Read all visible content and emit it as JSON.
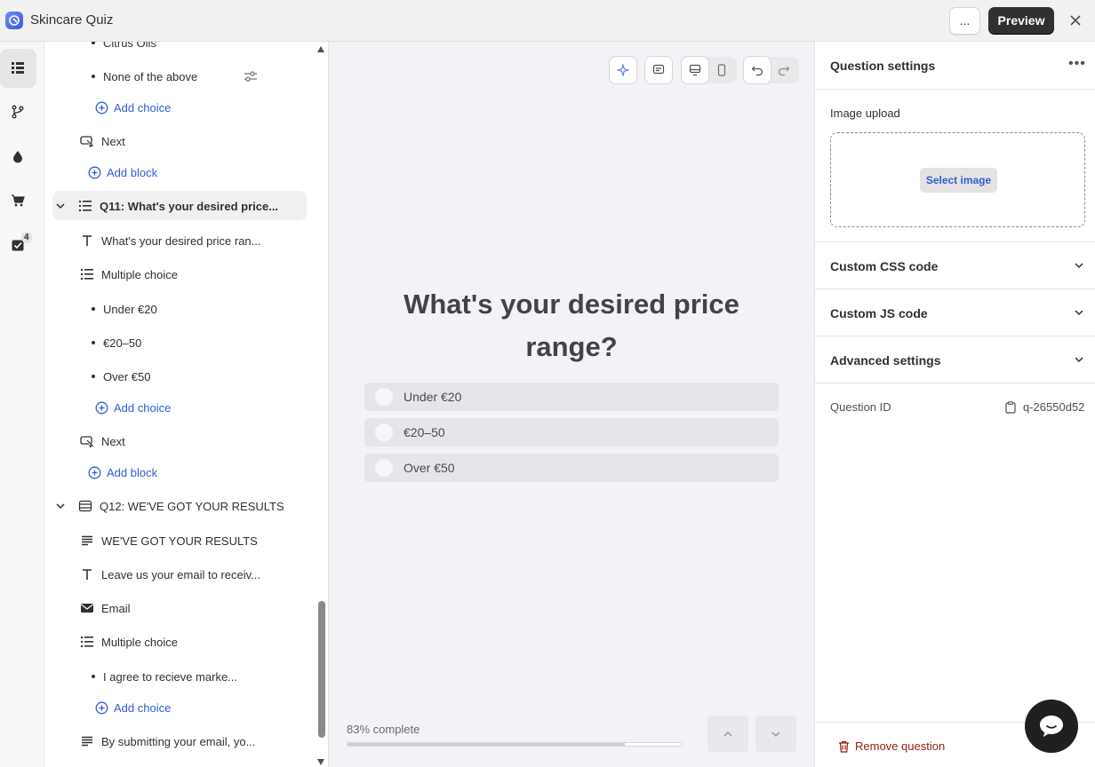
{
  "app": {
    "title": "Skincare Quiz",
    "more_label": "...",
    "preview_label": "Preview"
  },
  "rail": {
    "badge_count": "4"
  },
  "outline": {
    "rows": [
      {
        "text": "Citrus Oils",
        "kind": "choice"
      },
      {
        "text": "None of the above",
        "kind": "choice"
      },
      {
        "text": "Add choice",
        "kind": "add-choice"
      },
      {
        "text": "Next",
        "kind": "next"
      },
      {
        "text": "Add block",
        "kind": "add-block"
      },
      {
        "text": "Q11: What's your desired price...",
        "kind": "question"
      },
      {
        "text": "What's your desired price ran...",
        "kind": "text"
      },
      {
        "text": "Multiple choice",
        "kind": "list"
      },
      {
        "text": "Under €20",
        "kind": "choice"
      },
      {
        "text": "€20–50",
        "kind": "choice"
      },
      {
        "text": "Over €50",
        "kind": "choice"
      },
      {
        "text": "Add choice",
        "kind": "add-choice"
      },
      {
        "text": "Next",
        "kind": "next"
      },
      {
        "text": "Add block",
        "kind": "add-block"
      },
      {
        "text": "Q12: WE'VE GOT YOUR RESULTS",
        "kind": "question"
      },
      {
        "text": "WE'VE GOT YOUR RESULTS",
        "kind": "paragraph"
      },
      {
        "text": "Leave us your email to receiv...",
        "kind": "text"
      },
      {
        "text": "Email",
        "kind": "email"
      },
      {
        "text": "Multiple choice",
        "kind": "list"
      },
      {
        "text": "I agree to recieve marke...",
        "kind": "choice"
      },
      {
        "text": "Add choice",
        "kind": "add-choice"
      },
      {
        "text": "By submitting your email, yo...",
        "kind": "paragraph"
      }
    ]
  },
  "preview": {
    "question": "What's your desired price range?",
    "options": [
      "Under €20",
      "€20–50",
      "Over €50"
    ],
    "progress_label": "83% complete",
    "progress_fraction": 0.83
  },
  "settings": {
    "title": "Question settings",
    "image_upload_label": "Image upload",
    "select_image_label": "Select image",
    "sections": [
      "Custom CSS code",
      "Custom JS code",
      "Advanced settings"
    ],
    "question_id_label": "Question ID",
    "question_id_value": "q-26550d52",
    "remove_label": "Remove question"
  },
  "colors": {
    "accent": "#2c5fd3",
    "danger": "#8e1f0b",
    "primary_button": "#303030"
  }
}
